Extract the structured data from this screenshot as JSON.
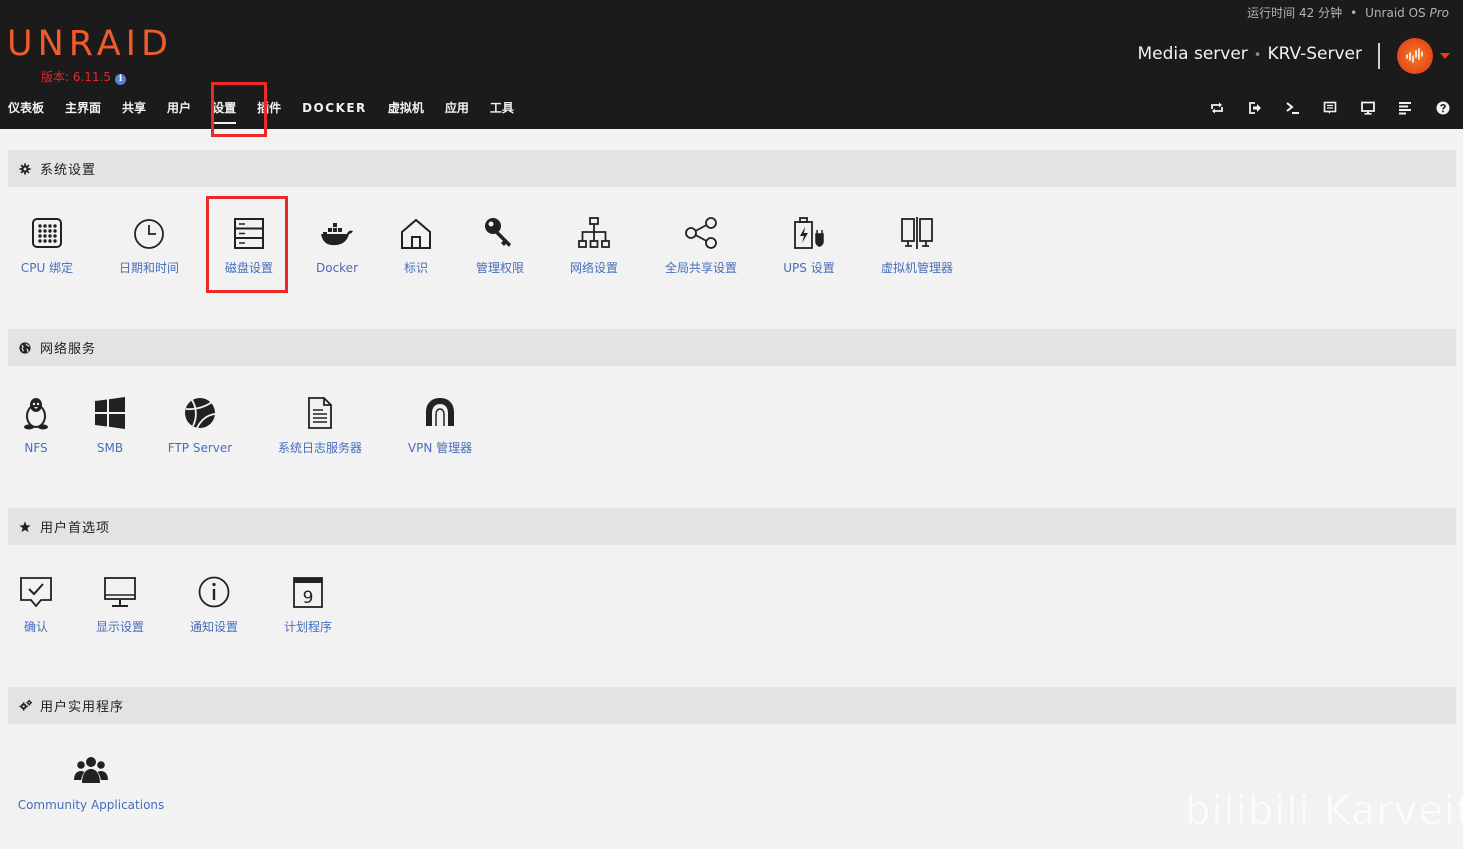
{
  "header": {
    "uptime": "运行时间 42 分钟",
    "separator": "•",
    "product_prefix": "Unraid OS ",
    "product_edition": "Pro",
    "logo": "UNRAID",
    "version": "版本: 6.11.5",
    "server_description": "Media server",
    "server_name": "KRV-Server",
    "accent_color": "#f15a2c",
    "highlight_color": "#ec2828"
  },
  "nav": {
    "items": [
      "仪表板",
      "主界面",
      "共享",
      "用户",
      "设置",
      "插件",
      "DOCKER",
      "虚拟机",
      "应用",
      "工具"
    ],
    "active": "设置",
    "icons": [
      "refresh-icon",
      "logout-icon",
      "terminal-icon",
      "feedback-icon",
      "monitor-icon",
      "log-icon",
      "help-icon"
    ]
  },
  "sections": {
    "system": {
      "title": "系统设置",
      "icon": "gear-icon",
      "tiles": [
        "CPU 绑定",
        "日期和时间",
        "磁盘设置",
        "Docker",
        "标识",
        "管理权限",
        "网络设置",
        "全局共享设置",
        "UPS 设置",
        "虚拟机管理器"
      ]
    },
    "network": {
      "title": "网络服务",
      "icon": "globe-icon",
      "tiles": [
        "NFS",
        "SMB",
        "FTP Server",
        "系统日志服务器",
        "VPN 管理器"
      ]
    },
    "prefs": {
      "title": "用户首选项",
      "icon": "star-icon",
      "tiles": [
        "确认",
        "显示设置",
        "通知设置",
        "计划程序"
      ],
      "calendar_day": "9"
    },
    "utilities": {
      "title": "用户实用程序",
      "icon": "gears-icon",
      "tiles": [
        "Community Applications"
      ]
    }
  },
  "watermark": "bilibili Karveit"
}
